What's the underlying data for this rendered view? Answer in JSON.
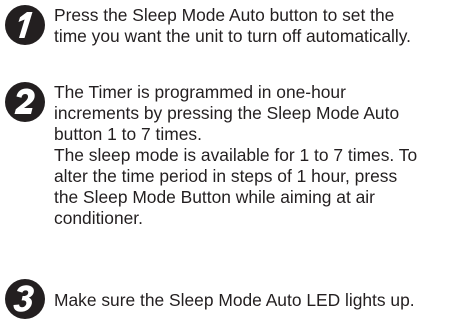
{
  "steps": [
    {
      "number": "1",
      "icon": "step-1-icon",
      "lines": [
        "Press the Sleep Mode Auto button to set the",
        "time you want the unit to turn off automatically."
      ]
    },
    {
      "number": "2",
      "icon": "step-2-icon",
      "lines": [
        "The Timer is programmed in one-hour",
        "increments by pressing the Sleep Mode Auto",
        "button 1 to 7 times.",
        "The sleep mode is available for 1 to 7 times. To",
        "alter the time period in steps of 1 hour, press",
        "the Sleep Mode Button while aiming at air",
        "conditioner."
      ]
    },
    {
      "number": "3",
      "icon": "step-3-icon",
      "lines": [
        "Make sure the Sleep Mode Auto LED lights up."
      ]
    }
  ]
}
